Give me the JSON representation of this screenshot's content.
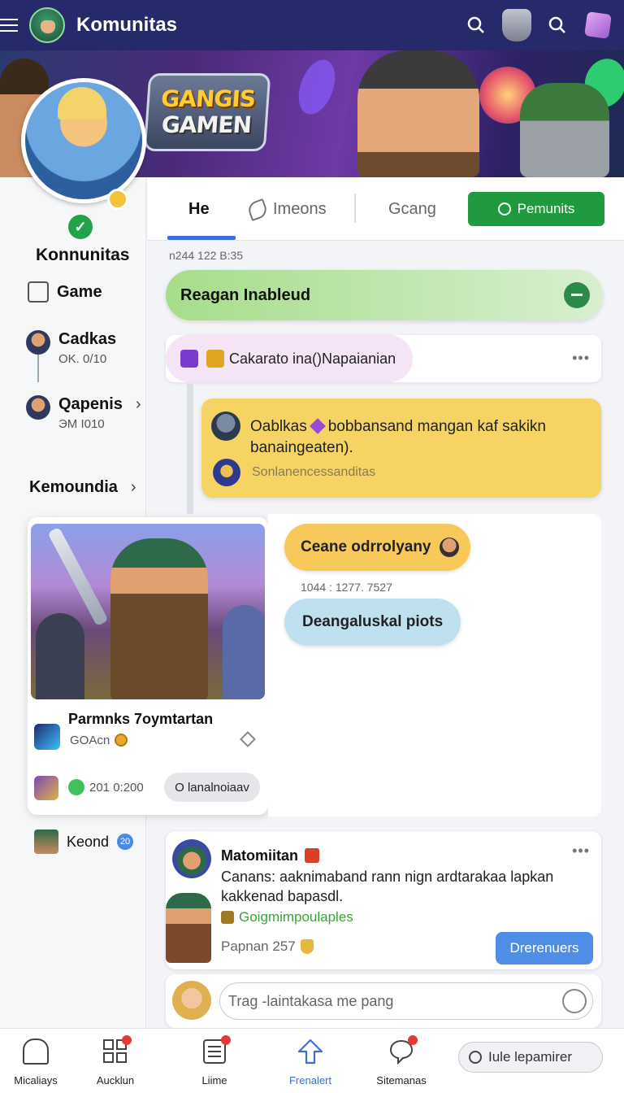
{
  "header": {
    "title": "Komunitas",
    "icons": [
      "menu-icon",
      "guild-avatar",
      "search-icon",
      "mask-icon",
      "search-icon",
      "cube-icon"
    ]
  },
  "banner": {
    "logo_line1": "GANGIS",
    "logo_line2": "GAMEN"
  },
  "sidebar": {
    "profile_name": "Konnunitas",
    "items": [
      {
        "label": "Game",
        "icon": "window-icon"
      },
      {
        "label": "Cadkas",
        "sub": "OK. 0/10",
        "icon": "avatar"
      },
      {
        "label": "Qapenis",
        "sub": "ЭМ I010",
        "icon": "avatar"
      }
    ],
    "section": "Kemoundia",
    "featured": {
      "title": "Parmnks 7oymtartan",
      "sub": "GOAcn",
      "count": "201 0:200",
      "button": "O lanalnoiaav"
    },
    "friend": {
      "label": "Keond",
      "badge": "20"
    }
  },
  "tabs": {
    "active": "He",
    "second": "Imeons",
    "third": "Gcang",
    "action_button": "Pemunits"
  },
  "feed": {
    "timestamp1": "n244 122 B:35",
    "pinned": "Reagan Inableud",
    "notice": "Cakarato ina()Napaianian",
    "reply": {
      "text_a": "Oablkas",
      "text_b": "bobbansand mangan kaf sakikn banaingeaten).",
      "sub": "Sonlanencessanditas"
    },
    "chat": {
      "bubble1": "Ceane odrrolyany",
      "time": "1044 : 1277. 7527",
      "bubble2": "Deangaluskal piots"
    },
    "post": {
      "author": "Matomiitan",
      "body": "Canans: aaknimaband rann nign ardtarakaa lapkan kakkenad bapasdl.",
      "link": "Goigmimpoulaples",
      "meta": "Papnan 257",
      "cta": "Drerenuers"
    },
    "composer_placeholder": "Trag -laintakasa me pang"
  },
  "bottom_nav": {
    "items": [
      {
        "label": "Micaliays",
        "icon": "home-icon"
      },
      {
        "label": "Aucklun",
        "icon": "grid-icon"
      },
      {
        "label": "Liime",
        "icon": "list-icon"
      },
      {
        "label": "Frenalert",
        "icon": "arrow-up-icon"
      },
      {
        "label": "Sitemanas",
        "icon": "chat-icon"
      }
    ],
    "search": "Iule lepamirer"
  },
  "colors": {
    "topbar": "#262a6a",
    "accent": "#3a6fd8",
    "action_green": "#1f9a3e"
  }
}
